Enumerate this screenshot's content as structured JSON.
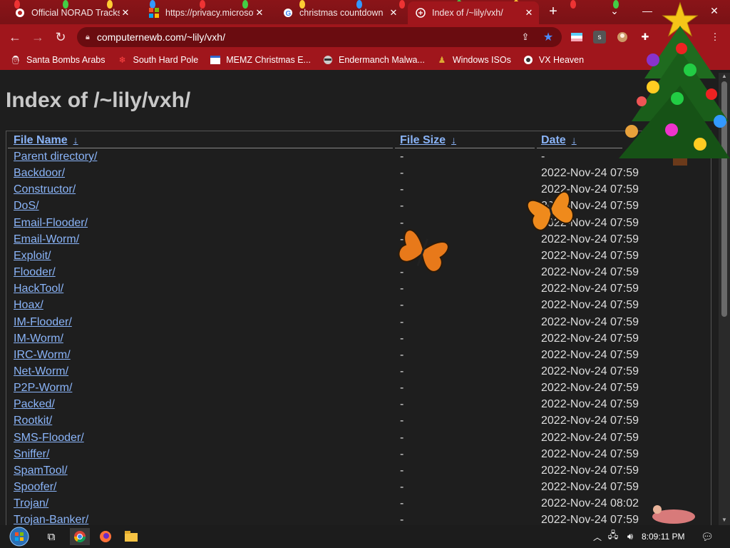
{
  "browser": {
    "tabs": [
      {
        "title": "Official NORAD Tracks",
        "favicon": "norad-icon",
        "active": false
      },
      {
        "title": "https://privacy.microsoft",
        "favicon": "microsoft-icon",
        "active": false
      },
      {
        "title": "christmas countdown",
        "favicon": "google-icon",
        "active": false
      },
      {
        "title": "Index of /~lily/vxh/",
        "favicon": "page-icon",
        "active": true
      }
    ],
    "new_tab_label": "+",
    "url": "computernewb.com/~lily/vxh/"
  },
  "bookmarks": [
    {
      "label": "Santa Bombs Arabs",
      "icon": "santa-icon"
    },
    {
      "label": "South Hard Pole",
      "icon": "snowflake-icon"
    },
    {
      "label": "MEMZ Christmas E...",
      "icon": "window-icon"
    },
    {
      "label": "Endermanch Malwa...",
      "icon": "raccoon-icon"
    },
    {
      "label": "Windows ISOs",
      "icon": "figure-icon"
    },
    {
      "label": "VX Heaven",
      "icon": "vx-icon"
    }
  ],
  "page": {
    "title": "Index of /~lily/vxh/",
    "columns": {
      "name": "File Name",
      "size": "File Size",
      "date": "Date",
      "sort_glyph": "↓"
    },
    "rows": [
      {
        "name": "Parent directory/",
        "size": "-",
        "date": "-"
      },
      {
        "name": "Backdoor/",
        "size": "-",
        "date": "2022-Nov-24 07:59"
      },
      {
        "name": "Constructor/",
        "size": "-",
        "date": "2022-Nov-24 07:59"
      },
      {
        "name": "DoS/",
        "size": "-",
        "date": "2022-Nov-24 07:59"
      },
      {
        "name": "Email-Flooder/",
        "size": "-",
        "date": "2022-Nov-24 07:59"
      },
      {
        "name": "Email-Worm/",
        "size": "-",
        "date": "2022-Nov-24 07:59"
      },
      {
        "name": "Exploit/",
        "size": "-",
        "date": "2022-Nov-24 07:59"
      },
      {
        "name": "Flooder/",
        "size": "-",
        "date": "2022-Nov-24 07:59"
      },
      {
        "name": "HackTool/",
        "size": "-",
        "date": "2022-Nov-24 07:59"
      },
      {
        "name": "Hoax/",
        "size": "-",
        "date": "2022-Nov-24 07:59"
      },
      {
        "name": "IM-Flooder/",
        "size": "-",
        "date": "2022-Nov-24 07:59"
      },
      {
        "name": "IM-Worm/",
        "size": "-",
        "date": "2022-Nov-24 07:59"
      },
      {
        "name": "IRC-Worm/",
        "size": "-",
        "date": "2022-Nov-24 07:59"
      },
      {
        "name": "Net-Worm/",
        "size": "-",
        "date": "2022-Nov-24 07:59"
      },
      {
        "name": "P2P-Worm/",
        "size": "-",
        "date": "2022-Nov-24 07:59"
      },
      {
        "name": "Packed/",
        "size": "-",
        "date": "2022-Nov-24 07:59"
      },
      {
        "name": "Rootkit/",
        "size": "-",
        "date": "2022-Nov-24 07:59"
      },
      {
        "name": "SMS-Flooder/",
        "size": "-",
        "date": "2022-Nov-24 07:59"
      },
      {
        "name": "Sniffer/",
        "size": "-",
        "date": "2022-Nov-24 07:59"
      },
      {
        "name": "SpamTool/",
        "size": "-",
        "date": "2022-Nov-24 07:59"
      },
      {
        "name": "Spoofer/",
        "size": "-",
        "date": "2022-Nov-24 07:59"
      },
      {
        "name": "Trojan/",
        "size": "-",
        "date": "2022-Nov-24 08:02"
      },
      {
        "name": "Trojan-Banker/",
        "size": "-",
        "date": "2022-Nov-24 07:59"
      }
    ]
  },
  "taskbar": {
    "clock": "8:09:11 PM",
    "items": [
      "start-orb-icon",
      "task-view-icon",
      "chrome-icon",
      "firefox-icon",
      "file-explorer-icon"
    ]
  },
  "colors": {
    "chrome_frame": "#a0161c",
    "link": "#8ab4f8",
    "page_bg": "#1e1e1e"
  }
}
